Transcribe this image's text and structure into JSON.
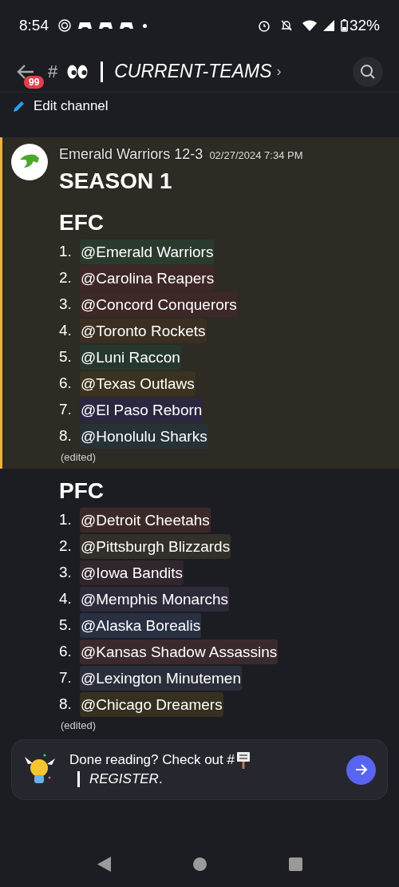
{
  "status_bar": {
    "time": "8:54",
    "battery": "32%"
  },
  "header": {
    "badge": "99",
    "hash": "#",
    "title": "CURRENT-TEAMS",
    "chevron": "›"
  },
  "edit_channel": "Edit channel",
  "messages": [
    {
      "highlighted": true,
      "author": "Emerald Warriors 12-3",
      "timestamp": "02/27/2024 7:34 PM",
      "title": "SEASON 1",
      "heading": "EFC",
      "edited": "(edited)",
      "items": [
        {
          "number": "1.",
          "mention": "@Emerald Warriors",
          "color": "#2b3a2f"
        },
        {
          "number": "2.",
          "mention": "@Carolina Reapers",
          "color": "#3d2727"
        },
        {
          "number": "3.",
          "mention": "@Concord Conquerors",
          "color": "#3d2828"
        },
        {
          "number": "4.",
          "mention": "@Toronto Rockets",
          "color": "#3b2f22"
        },
        {
          "number": "5.",
          "mention": "@Luni Raccon",
          "color": "#26382d"
        },
        {
          "number": "6.",
          "mention": "@Texas Outlaws",
          "color": "#3a3320"
        },
        {
          "number": "7.",
          "mention": "@El Paso Reborn",
          "color": "#2b2740"
        },
        {
          "number": "8.",
          "mention": "@Honolulu Sharks",
          "color": "#263238"
        }
      ]
    },
    {
      "highlighted": false,
      "heading": "PFC",
      "edited": "(edited)",
      "items": [
        {
          "number": "1.",
          "mention": "@Detroit Cheetahs",
          "color": "#3a2a27"
        },
        {
          "number": "2.",
          "mention": "@Pittsburgh Blizzards",
          "color": "#33302a"
        },
        {
          "number": "3.",
          "mention": "@Iowa Bandits",
          "color": "#31262b"
        },
        {
          "number": "4.",
          "mention": "@Memphis Monarchs",
          "color": "#2d2a3a"
        },
        {
          "number": "5.",
          "mention": "@Alaska Borealis",
          "color": "#283042"
        },
        {
          "number": "6.",
          "mention": "@Kansas Shadow Assassins",
          "color": "#3a2a2e"
        },
        {
          "number": "7.",
          "mention": "@Lexington Minutemen",
          "color": "#2a2e3a"
        },
        {
          "number": "8.",
          "mention": "@Chicago Dreamers",
          "color": "#35301f"
        }
      ]
    }
  ],
  "banner": {
    "text": "Done reading? Check out #",
    "channel": "*REGISTER*."
  }
}
